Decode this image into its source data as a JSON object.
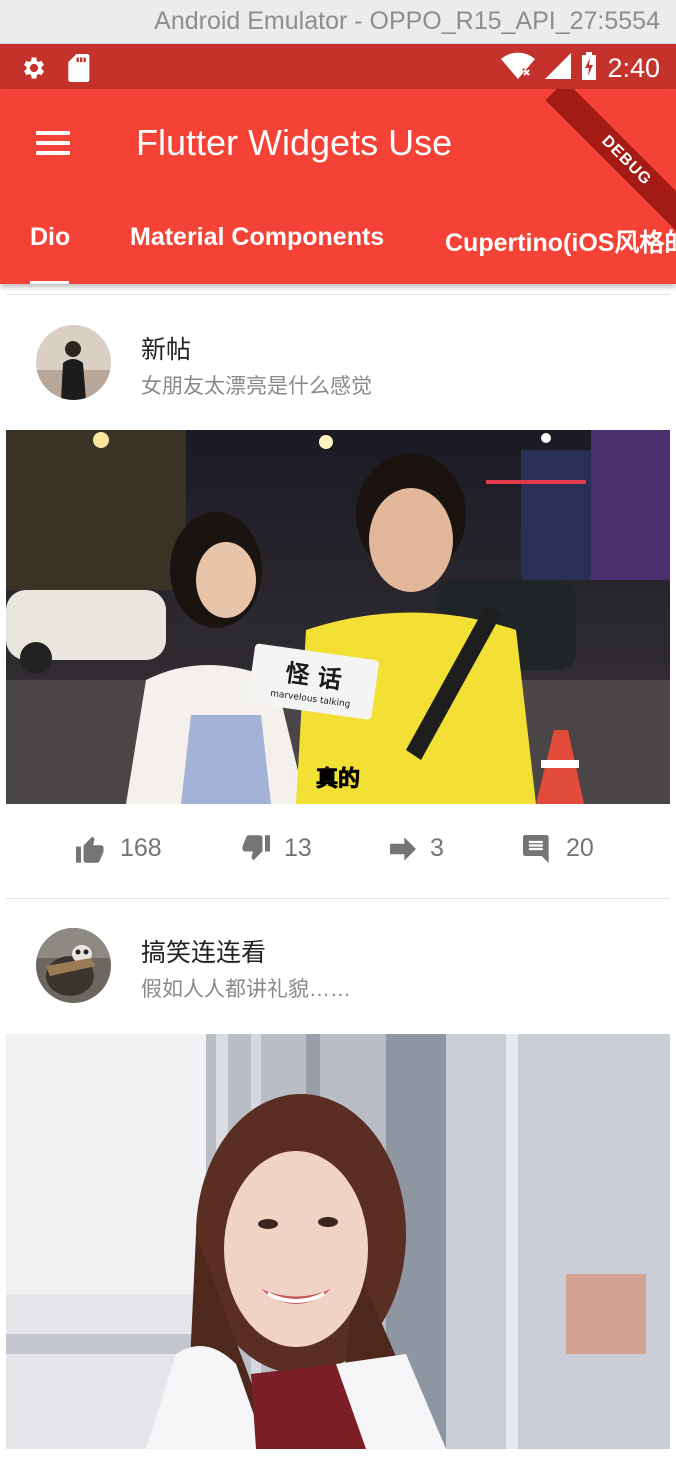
{
  "emulator": {
    "title": "Android Emulator - OPPO_R15_API_27:5554"
  },
  "status_bar": {
    "time": "2:40",
    "icons": [
      "settings-icon",
      "sd-card-icon",
      "wifi-icon",
      "signal-icon",
      "battery-charging-icon"
    ]
  },
  "app_bar": {
    "title": "Flutter Widgets Use",
    "menu_icon": "hamburger-menu-icon",
    "debug_badge": "DEBUG"
  },
  "tabs": [
    {
      "label": "Dio",
      "selected": true
    },
    {
      "label": "Material Components",
      "selected": false
    },
    {
      "label": "Cupertino(iOS风格的",
      "selected": false
    }
  ],
  "posts": [
    {
      "title": "新帖",
      "subtitle": "女朋友太漂亮是什么感觉",
      "image_caption": "真的",
      "image_logo": "怪 话",
      "image_logo_sub": "marvelous talking",
      "actions": {
        "likes": "168",
        "dislikes": "13",
        "shares": "3",
        "comments": "20"
      }
    },
    {
      "title": "搞笑连连看",
      "subtitle": "假如人人都讲礼貌……"
    }
  ],
  "colors": {
    "status_bar": "#c4332b",
    "app_bar": "#f44336",
    "action_gray": "#757575"
  }
}
